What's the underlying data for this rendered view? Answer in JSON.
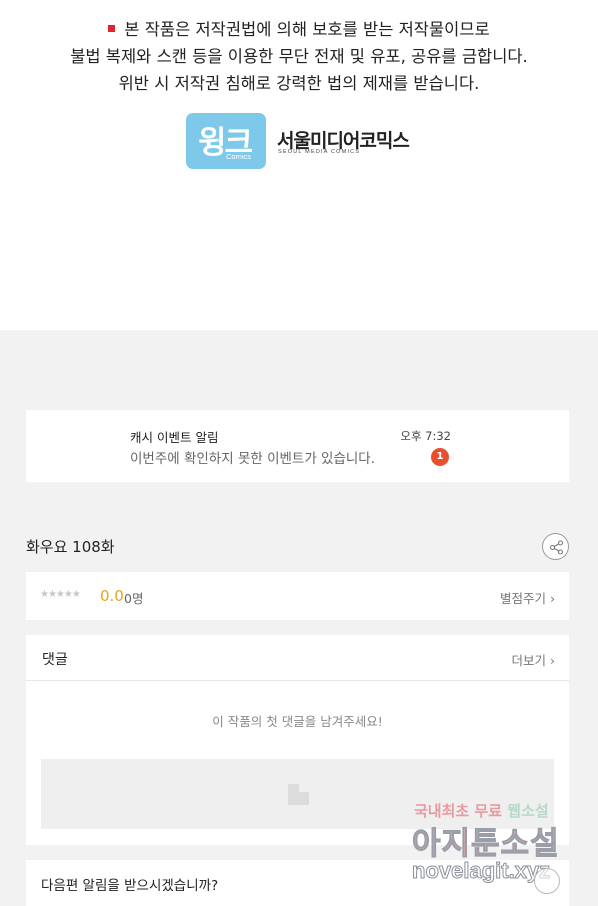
{
  "copyright_notice": {
    "line1": "본 작품은 저작권법에 의해 보호를 받는 저작물이므로",
    "line2": "불법 복제와 스캔 등을 이용한 무단 전재 및 유포, 공유를 금합니다.",
    "line3": "위반 시 저작권 침해로 강력한 법의 제재를 받습니다."
  },
  "logos": {
    "wink_text": "윙크",
    "wink_sub": "Comics",
    "seoul_text": "서울미디어코믹스",
    "seoul_sub": "SEOUL MEDIA COMICS"
  },
  "notification": {
    "title": "캐시 이벤트 알림",
    "time": "오후 7:32",
    "body": "이번주에 확인하지 못한 이벤트가 있습니다.",
    "badge": "1"
  },
  "episode": {
    "title": "화우요 108화"
  },
  "rating": {
    "stars": "★★★★★",
    "score": "0.0",
    "count": "0명",
    "rate_link": "별점주기 ›"
  },
  "comments": {
    "title": "댓글",
    "more": "더보기 ›",
    "empty_message": "이 작품의 첫 댓글을 남겨주세요!"
  },
  "next_alert": {
    "text": "다음편 알림을 받으시겠습니까?"
  },
  "watermark": {
    "line1_a": "국내최초 무료",
    "line1_b": "웹소설",
    "line2": "아지툰소설",
    "line3": "novelagit.xyz"
  },
  "colors": {
    "notice_bullet": "#e0262c",
    "wink_bg": "#7ec8ea",
    "score": "#f1a01a",
    "badge": "#e6502e",
    "page_bg": "#f2f2f2"
  }
}
